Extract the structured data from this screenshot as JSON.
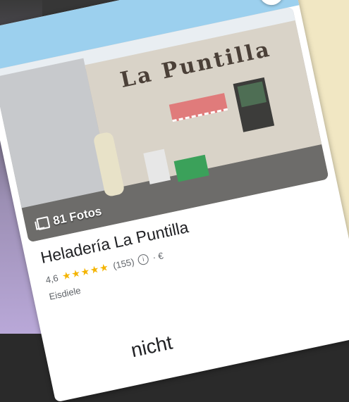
{
  "place": {
    "name": "Heladería La Puntilla",
    "rating": "4,6",
    "stars": "★★★★★",
    "review_count": "(155)",
    "price": "· €",
    "category": "Eisdiele"
  },
  "photo": {
    "sign_text": "La Puntilla",
    "photos_count_label": "81 Fotos"
  },
  "bottom_partial_text": "nicht",
  "icons": [
    "close-icon",
    "gallery-icon",
    "info-icon"
  ]
}
